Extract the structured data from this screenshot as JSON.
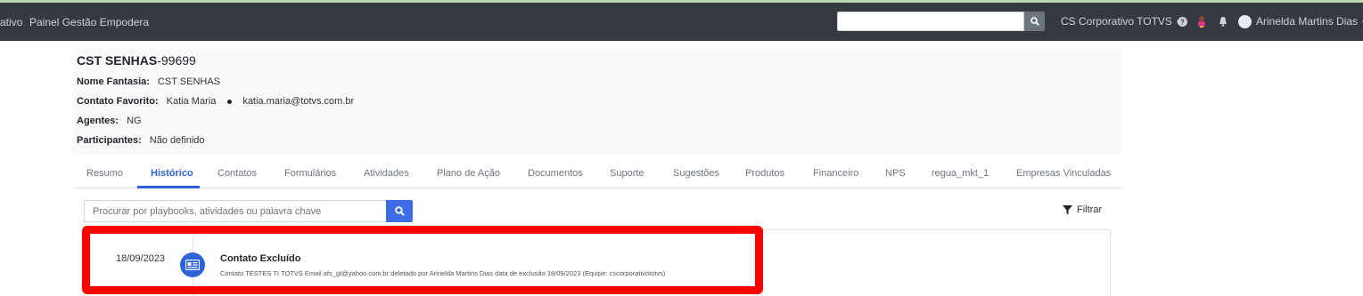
{
  "navbar": {
    "brand_partial": "ativo",
    "panel_link": "Painel Gestão Empodera",
    "search_value": "",
    "company_dropdown": "CS Corporativo TOTVS",
    "user_name": "Arinelda Martins Dias"
  },
  "customer": {
    "name_bold": "CST SENHAS",
    "id_suffix": "-99699",
    "fantasy_label": "Nome Fantasia:",
    "fantasy_value": "CST SENHAS",
    "favorite_label": "Contato Favorito:",
    "favorite_name": "Katia Maria",
    "favorite_email": "katia.maria@totvs.com.br",
    "agents_label": "Agentes:",
    "agents_value": "NG",
    "participants_label": "Participantes:",
    "participants_value": "Não definido"
  },
  "tabs": [
    {
      "label": "Resumo"
    },
    {
      "label": "Histórico"
    },
    {
      "label": "Contatos"
    },
    {
      "label": "Formulários"
    },
    {
      "label": "Atividades"
    },
    {
      "label": "Plano de Ação"
    },
    {
      "label": "Documentos"
    },
    {
      "label": "Suporte"
    },
    {
      "label": "Sugestões"
    },
    {
      "label": "Produtos"
    },
    {
      "label": "Financeiro"
    },
    {
      "label": "NPS"
    },
    {
      "label": "regua_mkt_1"
    },
    {
      "label": "Empresas Vinculadas"
    }
  ],
  "active_tab": "Histórico",
  "history_search": {
    "placeholder": "Procurar por playbooks, atividades ou palavra chave"
  },
  "filter_label": "Filtrar",
  "timeline": [
    {
      "date": "18/09/2023",
      "title": "Contato Excluído",
      "description": "Contato TESTES TI TOTVS Email afs_gt@yahoo.com.br deletado por Arinelda Martins Dias data de exclusão 18/09/2023 (Equipe: cscorporativototvs)",
      "icon": "contact-card-icon"
    }
  ],
  "colors": {
    "navbar": "#343a40",
    "accent": "#2e62d9",
    "highlight": "#ff0000"
  }
}
